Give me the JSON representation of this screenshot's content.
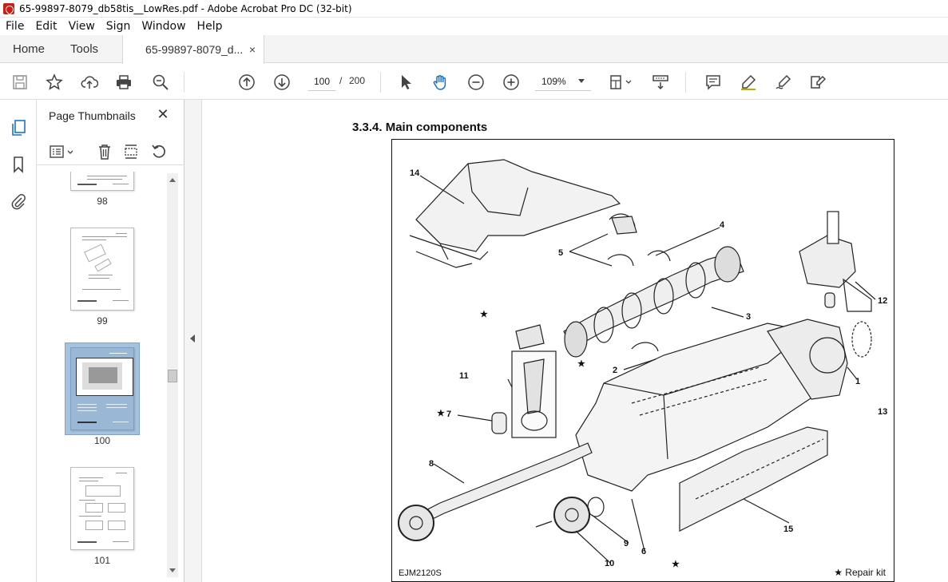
{
  "window": {
    "title": "65-99897-8079_db58tis__LowRes.pdf - Adobe Acrobat Pro DC (32-bit)"
  },
  "menu": [
    "File",
    "Edit",
    "View",
    "Sign",
    "Window",
    "Help"
  ],
  "tabs": {
    "home": "Home",
    "tools": "Tools",
    "document": "65-99897-8079_d...",
    "close": "×"
  },
  "toolbar": {
    "current_page": "100",
    "separator": "/",
    "total_pages": "200",
    "zoom": "109%"
  },
  "panel": {
    "title": "Page Thumbnails",
    "close": "✕",
    "thumbnails": [
      {
        "label": "98",
        "selected": false
      },
      {
        "label": "99",
        "selected": false
      },
      {
        "label": "100",
        "selected": true
      },
      {
        "label": "101",
        "selected": false
      }
    ]
  },
  "document": {
    "heading": "3.3.4. Main components",
    "figure_code": "EJM2120S",
    "figure_note": "★ Repair kit",
    "callouts": [
      "14",
      "4",
      "5",
      "12",
      "3",
      "1",
      "2",
      "11",
      "13",
      "7",
      "8",
      "15",
      "9",
      "6",
      "10",
      "★",
      "★",
      "★",
      "★"
    ]
  }
}
